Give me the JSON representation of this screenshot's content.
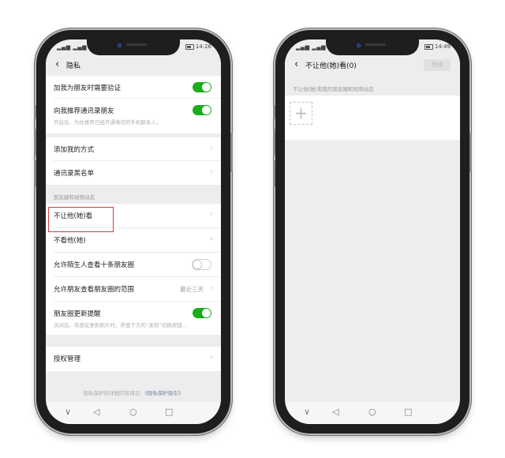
{
  "left_phone": {
    "status": {
      "carrier": "▂▄▆ ▂▄▆ ≈",
      "time": "14:26"
    },
    "nav": {
      "back_icon": "‹",
      "title": "隐私"
    },
    "rows": [
      {
        "label": "加我为朋友时需要验证",
        "toggle": "on"
      },
      {
        "label": "向我推荐通讯录朋友",
        "sub": "开启后，为你推荐已经开通微信的手机联系人。",
        "toggle": "on"
      },
      {
        "label": "添加我的方式"
      },
      {
        "label": "通讯录黑名单"
      },
      {
        "label": "不让他(她)看"
      },
      {
        "label": "不看他(她)"
      },
      {
        "label": "允许陌生人查看十条朋友圈",
        "toggle": "off"
      },
      {
        "label": "允许朋友查看朋友圈的范围",
        "value": "最近三天"
      },
      {
        "label": "朋友圈更新提醒",
        "sub": "关闭后，有朋友更新照片时，界面下方的“发现”切换按钮...",
        "toggle": "on"
      },
      {
        "label": "授权管理"
      }
    ],
    "section_title": "朋友圈和视频动态",
    "footer": {
      "text": "隐私保护的详细内容请见：",
      "link": "《隐私保护指引》"
    },
    "sysnav": {
      "down": "∨",
      "back": "◁",
      "home": "○",
      "recent": "□"
    }
  },
  "right_phone": {
    "status": {
      "carrier": "▂▄▆ ▂▄▆ ≈",
      "time": "14:49"
    },
    "nav": {
      "back_icon": "‹",
      "title": "不让他(她)看(0)",
      "done": "完成"
    },
    "section_title": "不让他(她)看我的朋友圈和视频动态",
    "add_icon": "+",
    "sysnav": {
      "down": "∨",
      "back": "◁",
      "home": "○",
      "recent": "□"
    }
  },
  "colors": {
    "toggle_on": "#1aad19",
    "highlight": "#d83b3b",
    "link": "#6d7fa6"
  }
}
